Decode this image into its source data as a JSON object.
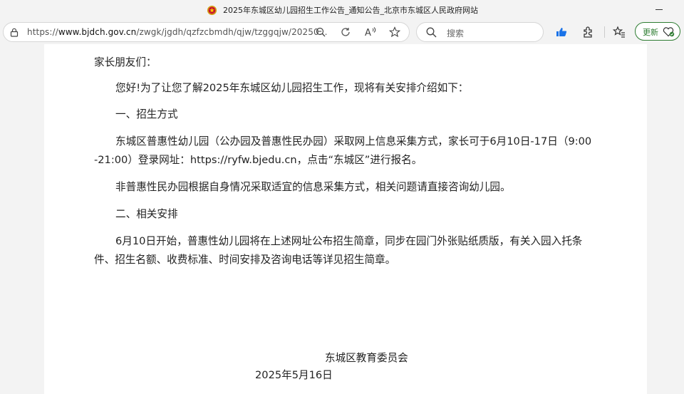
{
  "browser": {
    "tab_title": "2025年东城区幼儿园招生工作公告_通知公告_北京市东城区人民政府网站",
    "url_prefix": "https://",
    "url_domain": "www.bjdch.gov.cn",
    "url_path": "/zwgk/jgdh/qzfzcbmdh/qjw/tzggqjw/20250...",
    "search_placeholder": "搜索",
    "update_label": "更新",
    "icons": [
      "lock-icon",
      "zoom-out-icon",
      "refresh-icon",
      "read-aloud-icon",
      "star-icon",
      "search-icon",
      "thumbs-up-icon",
      "extensions-icon",
      "favorites-icon",
      "heart-pulse-icon",
      "minimize-icon"
    ]
  },
  "article": {
    "salutation": "家长朋友们：",
    "intro": "您好!为了让您了解2025年东城区幼儿园招生工作，现将有关安排介绍如下：",
    "section1_heading": "一、招生方式",
    "para1_line1": "东城区普惠性幼儿园（公办园及普惠性民办园）采取网上信息采集方式，家长可于6月10日-17日（9:00",
    "para1_line2": "-21:00）登录网址：https://ryfw.bjedu.cn，点击“东城区”进行报名。",
    "para2": "非普惠性民办园根据自身情况采取适宜的信息采集方式，相关问题请直接咨询幼儿园。",
    "section2_heading": "二、相关安排",
    "para3_line1": "6月10日开始，普惠性幼儿园将在上述网址公布招生简章，同步在园门外张贴纸质版，有关入园入托条",
    "para3_line2": "件、招生名额、收费标准、时间安排及咨询电话等详见招生简章。",
    "signature_org": "东城区教育委员会",
    "signature_date": "2025年5月16日"
  }
}
